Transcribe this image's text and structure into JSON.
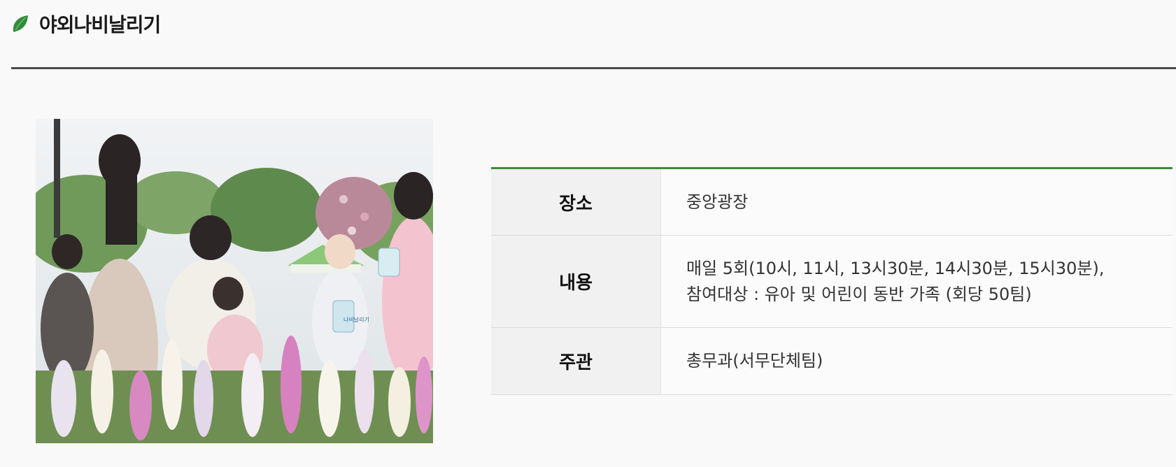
{
  "header": {
    "title": "야외나비날리기",
    "icon": "leaf-icon",
    "accent_color": "#2e8b3a"
  },
  "photo": {
    "sign_text": "나비날리기"
  },
  "info": {
    "rows": [
      {
        "label": "장소",
        "lines": [
          "중앙광장"
        ]
      },
      {
        "label": "내용",
        "lines": [
          "매일 5회(10시, 11시, 13시30분, 14시30분, 15시30분),",
          "참여대상 : 유아 및 어린이 동반 가족 (회당 50팀)"
        ]
      },
      {
        "label": "주관",
        "lines": [
          "총무과(서무단체팀)"
        ]
      }
    ]
  },
  "colors": {
    "table_top_border": "#3f8a3a",
    "title_rule": "#4a4a4a"
  }
}
